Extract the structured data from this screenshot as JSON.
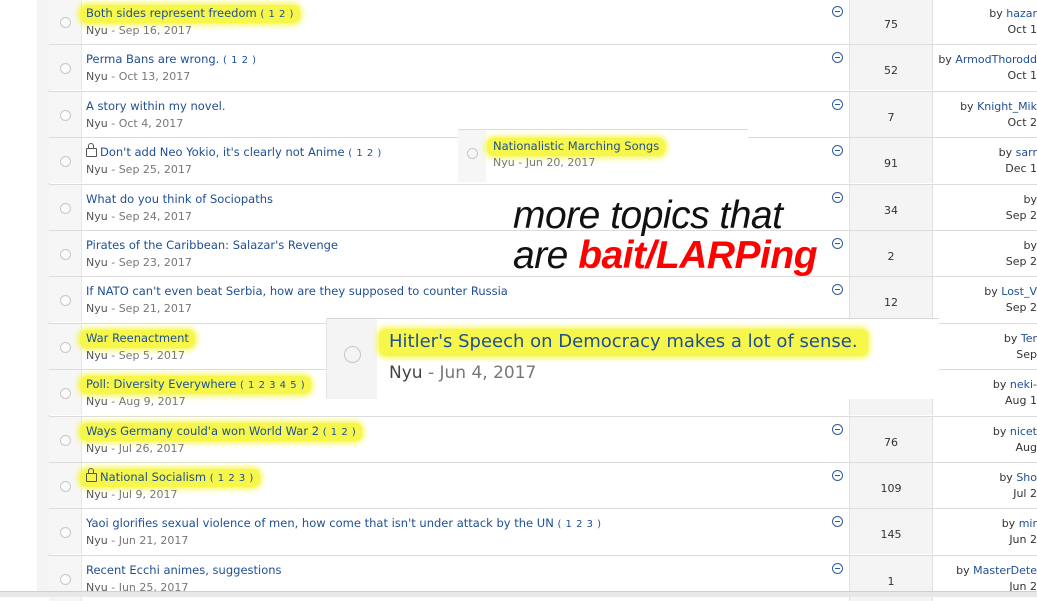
{
  "topics": [
    {
      "title": "Both sides represent freedom",
      "pages": "( 1 2 )",
      "author": "Nyu",
      "date": "Sep 16, 2017",
      "count": "75",
      "last_user": "hazar",
      "last_date": "Oct 1",
      "highlight": true,
      "locked": false
    },
    {
      "title": "Perma Bans are wrong.",
      "pages": "( 1 2 )",
      "author": "Nyu",
      "date": "Oct 13, 2017",
      "count": "52",
      "last_user": "ArmodThorodd",
      "last_date": "Oct 1",
      "highlight": false,
      "locked": false
    },
    {
      "title": "A story within my novel.",
      "pages": "",
      "author": "Nyu",
      "date": "Oct 4, 2017",
      "count": "7",
      "last_user": "Knight_Mik",
      "last_date": "Oct 2",
      "highlight": false,
      "locked": false
    },
    {
      "title": "Don't add Neo Yokio, it's clearly not Anime",
      "pages": "( 1 2 )",
      "author": "Nyu",
      "date": "Sep 25, 2017",
      "count": "91",
      "last_user": "sarr",
      "last_date": "Dec 1",
      "highlight": false,
      "locked": true
    },
    {
      "title": "What do you think of Sociopaths",
      "pages": "",
      "author": "Nyu",
      "date": "Sep 24, 2017",
      "count": "34",
      "last_user": "",
      "last_date": "Sep 2",
      "highlight": false,
      "locked": false
    },
    {
      "title": "Pirates of the Caribbean: Salazar's Revenge",
      "pages": "",
      "author": "Nyu",
      "date": "Sep 23, 2017",
      "count": "2",
      "last_user": "",
      "last_date": "Sep 2",
      "highlight": false,
      "locked": false
    },
    {
      "title": "If NATO can't even beat Serbia, how are they supposed to counter Russia",
      "pages": "",
      "author": "Nyu",
      "date": "Sep 21, 2017",
      "count": "12",
      "last_user": "Lost_V",
      "last_date": "Sep 2",
      "highlight": false,
      "locked": false
    },
    {
      "title": "War Reenactment",
      "pages": "",
      "author": "Nyu",
      "date": "Sep 5, 2017",
      "count": "",
      "last_user": "Ter",
      "last_date": "Sep",
      "highlight": true,
      "locked": false
    },
    {
      "title": "Poll: Diversity Everywhere",
      "pages": "( 1 2 3 4 5 )",
      "author": "Nyu",
      "date": "Aug 9, 2017",
      "count": "",
      "last_user": "neki-",
      "last_date": "Aug 1",
      "highlight": true,
      "locked": false
    },
    {
      "title": "Ways Germany could'a won World War 2",
      "pages": "( 1 2 )",
      "author": "Nyu",
      "date": "Jul 26, 2017",
      "count": "76",
      "last_user": "nicet",
      "last_date": "Aug",
      "highlight": true,
      "locked": false
    },
    {
      "title": "National Socialism",
      "pages": "( 1 2 3 )",
      "author": "Nyu",
      "date": "Jul 9, 2017",
      "count": "109",
      "last_user": "Sho",
      "last_date": "Jul 2",
      "highlight": true,
      "locked": true
    },
    {
      "title": "Yaoi glorifies sexual violence of men, how come that isn't under attack by the UN",
      "pages": "( 1 2 3 )",
      "author": "Nyu",
      "date": "Jun 21, 2017",
      "count": "145",
      "last_user": "mir",
      "last_date": "Jun 2",
      "highlight": false,
      "locked": false
    },
    {
      "title": "Recent Ecchi animes, suggestions",
      "pages": "",
      "author": "Nyu",
      "date": "Jun 25, 2017",
      "count": "1",
      "last_user": "MasterDete",
      "last_date": "Jun 2",
      "highlight": false,
      "locked": false
    }
  ],
  "by_label": "by",
  "date_sep": "-",
  "overlay_small": {
    "title": "Nationalistic Marching Songs",
    "author": "Nyu",
    "date": "Jun 20, 2017"
  },
  "overlay_big": {
    "title": "Hitler's Speech on Democracy makes a lot of sense.",
    "author": "Nyu",
    "date": "Jun 4, 2017"
  },
  "annotation": {
    "line1": "more topics that",
    "line2_prefix": "are ",
    "line2_red": "bait/LARPing"
  },
  "colors": {
    "link": "#1f4f94",
    "highlight": "#f6f74a",
    "annotation_red": "#ff0000"
  }
}
